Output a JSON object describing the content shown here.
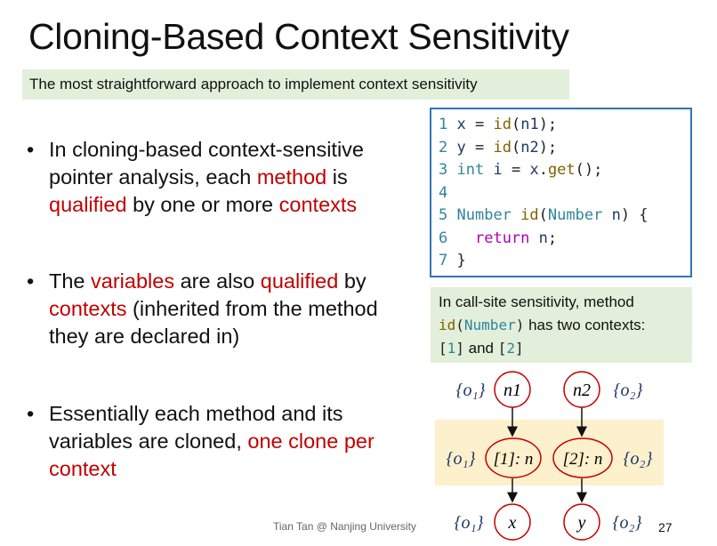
{
  "title": "Cloning-Based Context Sensitivity",
  "subtitle": "The most straightforward approach to implement context sensitivity",
  "bullets": [
    {
      "parts": [
        "In cloning-based context-sensitive pointer analysis, each ",
        "method",
        " is ",
        "qualified",
        " by one or more ",
        "contexts",
        ""
      ]
    },
    {
      "parts": [
        "The ",
        "variables",
        " are also ",
        "qualified",
        " by ",
        "contexts",
        " (inherited from the method they are declared in)"
      ]
    },
    {
      "parts": [
        "Essentially each method and its variables are cloned, ",
        "one clone per context",
        "",
        "",
        "",
        "",
        ""
      ]
    }
  ],
  "code": {
    "lines": [
      {
        "n": "1",
        "tokens": [
          [
            "v",
            "x"
          ],
          [
            "pn",
            " = "
          ],
          [
            "fn",
            "id"
          ],
          [
            "pn",
            "("
          ],
          [
            "v",
            "n1"
          ],
          [
            "pn",
            ");"
          ]
        ]
      },
      {
        "n": "2",
        "tokens": [
          [
            "v",
            "y"
          ],
          [
            "pn",
            " = "
          ],
          [
            "fn",
            "id"
          ],
          [
            "pn",
            "("
          ],
          [
            "v",
            "n2"
          ],
          [
            "pn",
            ");"
          ]
        ]
      },
      {
        "n": "3",
        "tokens": [
          [
            "ty",
            "int"
          ],
          [
            "pn",
            " "
          ],
          [
            "v",
            "i"
          ],
          [
            "pn",
            " = "
          ],
          [
            "v",
            "x"
          ],
          [
            "pn",
            "."
          ],
          [
            "fn",
            "get"
          ],
          [
            "pn",
            "();"
          ]
        ]
      },
      {
        "n": "4",
        "tokens": []
      },
      {
        "n": "5",
        "tokens": [
          [
            "ty",
            "Number"
          ],
          [
            "pn",
            " "
          ],
          [
            "fn",
            "id"
          ],
          [
            "pn",
            "("
          ],
          [
            "ty",
            "Number"
          ],
          [
            "pn",
            " "
          ],
          [
            "v",
            "n"
          ],
          [
            "pn",
            ") {"
          ]
        ]
      },
      {
        "n": "6",
        "tokens": [
          [
            "pn",
            "  "
          ],
          [
            "kw",
            "return"
          ],
          [
            "pn",
            " "
          ],
          [
            "v",
            "n"
          ],
          [
            "pn",
            ";"
          ]
        ]
      },
      {
        "n": "7",
        "tokens": [
          [
            "pn",
            "}"
          ]
        ]
      }
    ]
  },
  "note": {
    "line1": "In call-site sensitivity, method",
    "id": "id",
    "paren_open": "(",
    "type": "Number",
    "paren_close": ")",
    "line2_rest": " has two contexts:",
    "ctx1_open": "[",
    "ctx1": "1",
    "ctx1_close": "]",
    "and": " and ",
    "ctx2_open": "[",
    "ctx2": "2",
    "ctx2_close": "]"
  },
  "diagram": {
    "nodes": {
      "n1": "n1",
      "n2": "n2",
      "c1": "[1]: n",
      "c2": "[2]: n",
      "x": "x",
      "y": "y"
    },
    "pts": {
      "o1": "{o₁}",
      "o2": "{o₂}"
    },
    "colors": {
      "node_stroke": "#c00000",
      "band": "#fdf0cc"
    }
  },
  "footer": "Tian Tan @ Nanjing University",
  "page_number": "27",
  "colors": {
    "accent_red": "#c00000",
    "note_bg": "#e2efda",
    "code_border": "#2e75b6"
  }
}
